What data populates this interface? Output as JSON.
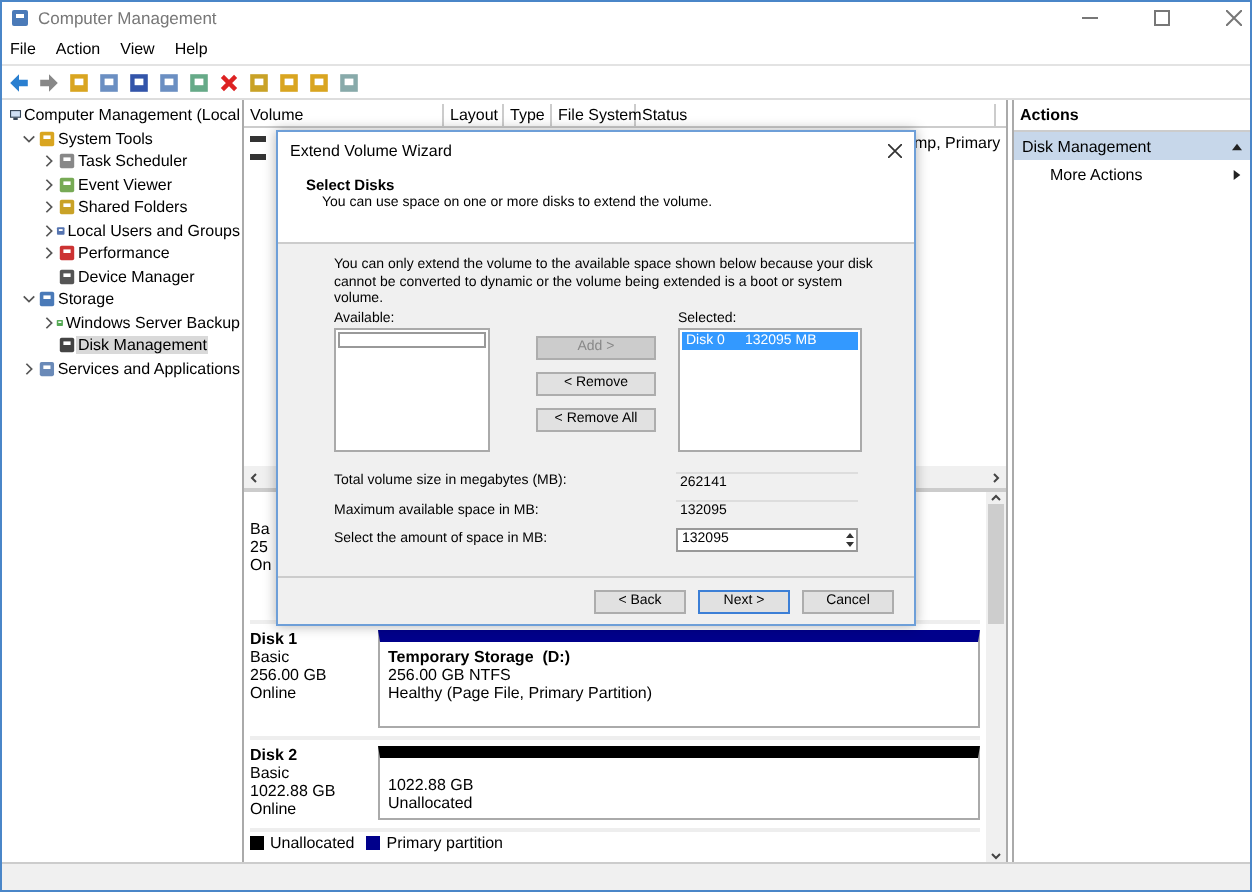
{
  "window": {
    "title": "Computer Management"
  },
  "menu": [
    "File",
    "Action",
    "View",
    "Help"
  ],
  "tree": [
    {
      "label": "Computer Management (Local",
      "kind": "root",
      "selected": false,
      "children": [
        {
          "label": "System Tools",
          "kind": "expanded",
          "selected": false,
          "children": [
            {
              "label": "Task Scheduler",
              "kind": "collapsed",
              "selected": false
            },
            {
              "label": "Event Viewer",
              "kind": "collapsed",
              "selected": false
            },
            {
              "label": "Shared Folders",
              "kind": "collapsed",
              "selected": false
            },
            {
              "label": "Local Users and Groups",
              "kind": "collapsed",
              "selected": false
            },
            {
              "label": "Performance",
              "kind": "collapsed",
              "selected": false
            },
            {
              "label": "Device Manager",
              "kind": "leaf",
              "selected": false
            }
          ]
        },
        {
          "label": "Storage",
          "kind": "expanded",
          "selected": false,
          "children": [
            {
              "label": "Windows Server Backup",
              "kind": "collapsed",
              "selected": false
            },
            {
              "label": "Disk Management",
              "kind": "leaf",
              "selected": true
            }
          ]
        },
        {
          "label": "Services and Applications",
          "kind": "collapsed",
          "selected": false
        }
      ]
    }
  ],
  "volume_table": {
    "columns": [
      "Volume",
      "Layout",
      "Type",
      "File System",
      "Status"
    ],
    "rows": [
      {
        "status": "mp, Primary"
      }
    ]
  },
  "disks": [
    {
      "type": "Ba",
      "size": "25",
      "state": "On"
    },
    {
      "name": "Disk 1",
      "type": "Basic",
      "size": "256.00 GB",
      "state": "Online",
      "partitions": [
        {
          "kind": "primary",
          "title": "Temporary Storage  (D:)",
          "lines": [
            "256.00 GB NTFS",
            "Healthy (Page File, Primary Partition)"
          ]
        }
      ]
    },
    {
      "name": "Disk 2",
      "type": "Basic",
      "size": "1022.88 GB",
      "state": "Online",
      "partitions": [
        {
          "kind": "unallocated",
          "lines": [
            "1022.88 GB",
            "Unallocated"
          ]
        }
      ]
    }
  ],
  "legend": [
    {
      "label": "Unallocated",
      "color": "#000000"
    },
    {
      "label": "Primary partition",
      "color": "#00008b"
    }
  ],
  "actions": {
    "title": "Actions",
    "items": [
      {
        "label": "Disk Management",
        "kind": "header"
      },
      {
        "label": "More Actions",
        "kind": "item"
      }
    ]
  },
  "dialog": {
    "title": "Extend Volume Wizard",
    "heading": "Select Disks",
    "subheading": "You can use space on one or more disks to extend the volume.",
    "note": "You can only extend the volume to the available space shown below because your disk cannot be converted to dynamic or the volume being extended is a boot or system volume.",
    "available_label": "Available:",
    "selected_label": "Selected:",
    "selected_items": [
      {
        "cells": [
          "Disk 0",
          "132095 MB"
        ],
        "selected": true
      }
    ],
    "move_buttons": [
      {
        "label": "Add >",
        "disabled": true
      },
      {
        "label": "< Remove",
        "disabled": false
      },
      {
        "label": "< Remove All",
        "disabled": false
      }
    ],
    "fields": [
      {
        "label": "Total volume size in megabytes (MB):",
        "value": "262141",
        "kind": "readonly"
      },
      {
        "label": "Maximum available space in MB:",
        "value": "132095",
        "kind": "readonly"
      },
      {
        "label": "Select the amount of space in MB:",
        "value": "132095",
        "kind": "spin"
      }
    ],
    "footer_buttons": [
      {
        "label": "< Back",
        "focused": false
      },
      {
        "label": "Next >",
        "focused": true
      },
      {
        "label": "Cancel",
        "focused": false
      }
    ]
  }
}
